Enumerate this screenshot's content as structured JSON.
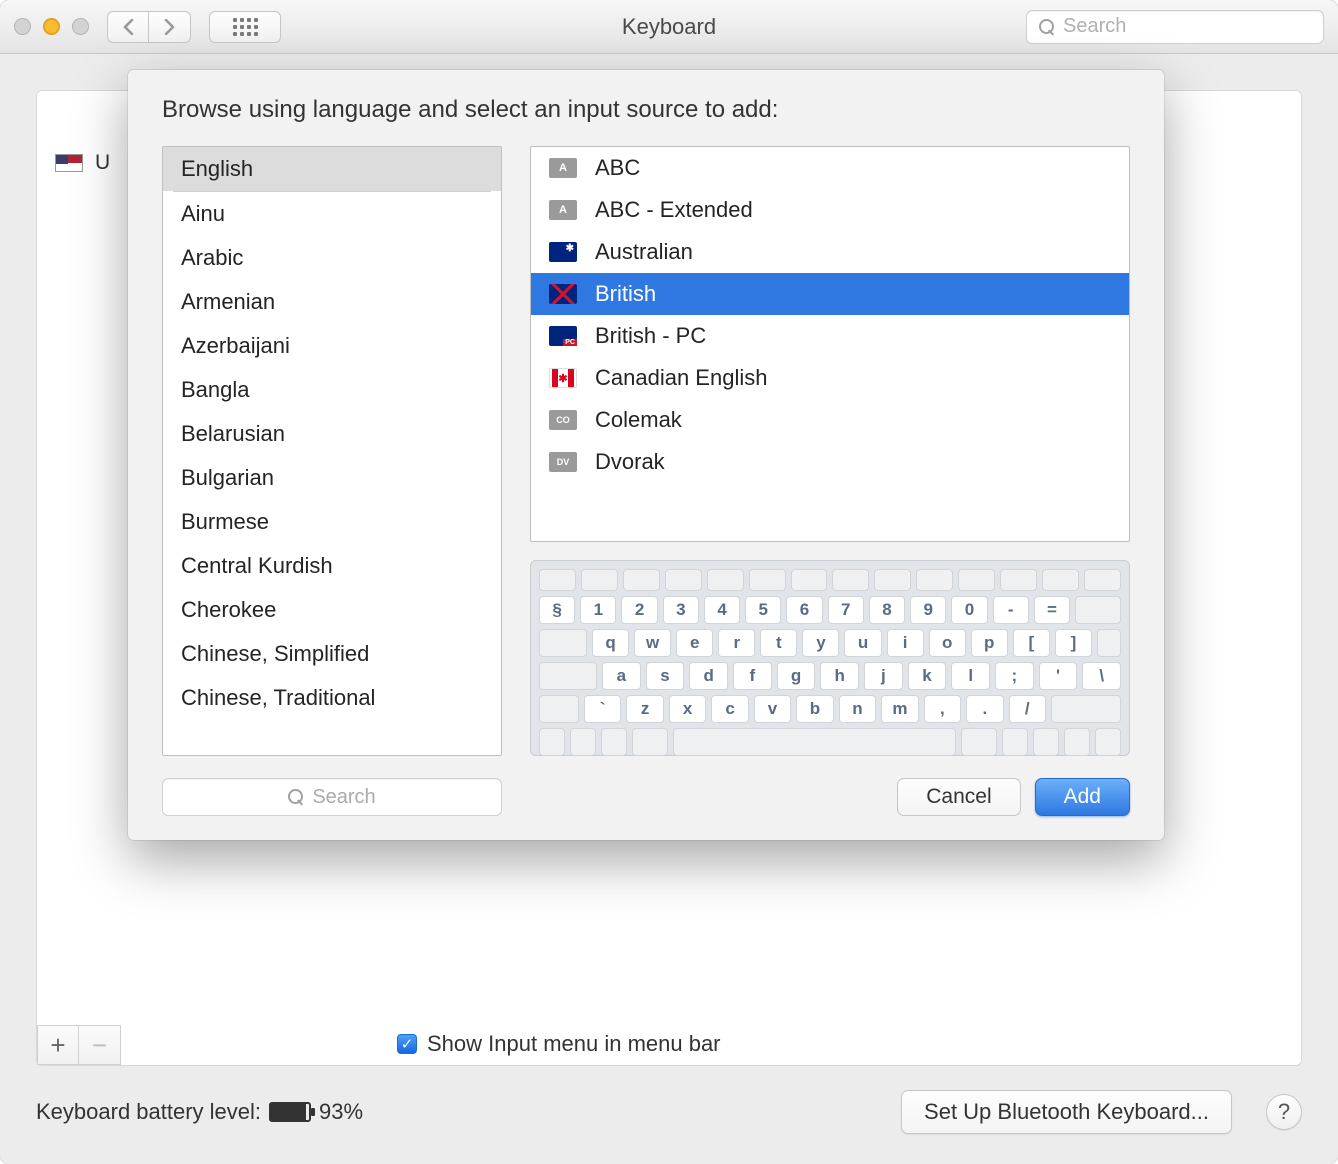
{
  "window": {
    "title": "Keyboard"
  },
  "toolbar": {
    "search_placeholder": "Search"
  },
  "bg": {
    "existing_source": "U",
    "checkbox_label": "Show Input menu in menu bar",
    "checkbox_checked": true
  },
  "footer": {
    "battery_label": "Keyboard battery level:",
    "battery_percent": "93%",
    "battery_fill": 93,
    "setup_btn": "Set Up Bluetooth Keyboard...",
    "help": "?"
  },
  "sheet": {
    "prompt": "Browse using language and select an input source to add:",
    "languages": [
      "English",
      "Ainu",
      "Arabic",
      "Armenian",
      "Azerbaijani",
      "Bangla",
      "Belarusian",
      "Bulgarian",
      "Burmese",
      "Central Kurdish",
      "Cherokee",
      "Chinese, Simplified",
      "Chinese, Traditional"
    ],
    "selected_language_index": 0,
    "sources": [
      {
        "label": "ABC",
        "icon": "A",
        "selected": false
      },
      {
        "label": "ABC - Extended",
        "icon": "A",
        "selected": false
      },
      {
        "label": "Australian",
        "icon": "au",
        "selected": false
      },
      {
        "label": "British",
        "icon": "uk",
        "selected": true
      },
      {
        "label": "British - PC",
        "icon": "ukpc",
        "selected": false
      },
      {
        "label": "Canadian English",
        "icon": "ca",
        "selected": false
      },
      {
        "label": "Colemak",
        "icon": "CO",
        "selected": false
      },
      {
        "label": "Dvorak",
        "icon": "DV",
        "selected": false
      }
    ],
    "keyboard": {
      "row0": [
        "",
        "",
        "",
        "",
        "",
        "",
        "",
        "",
        "",
        "",
        "",
        "",
        "",
        ""
      ],
      "row1": [
        "§",
        "1",
        "2",
        "3",
        "4",
        "5",
        "6",
        "7",
        "8",
        "9",
        "0",
        "-",
        "="
      ],
      "row2": [
        "q",
        "w",
        "e",
        "r",
        "t",
        "y",
        "u",
        "i",
        "o",
        "p",
        "[",
        "]"
      ],
      "row3": [
        "a",
        "s",
        "d",
        "f",
        "g",
        "h",
        "j",
        "k",
        "l",
        ";",
        "'",
        "\\"
      ],
      "row4": [
        "`",
        "z",
        "x",
        "c",
        "v",
        "b",
        "n",
        "m",
        ",",
        ".",
        "/"
      ]
    },
    "search_placeholder": "Search",
    "cancel": "Cancel",
    "add": "Add"
  }
}
